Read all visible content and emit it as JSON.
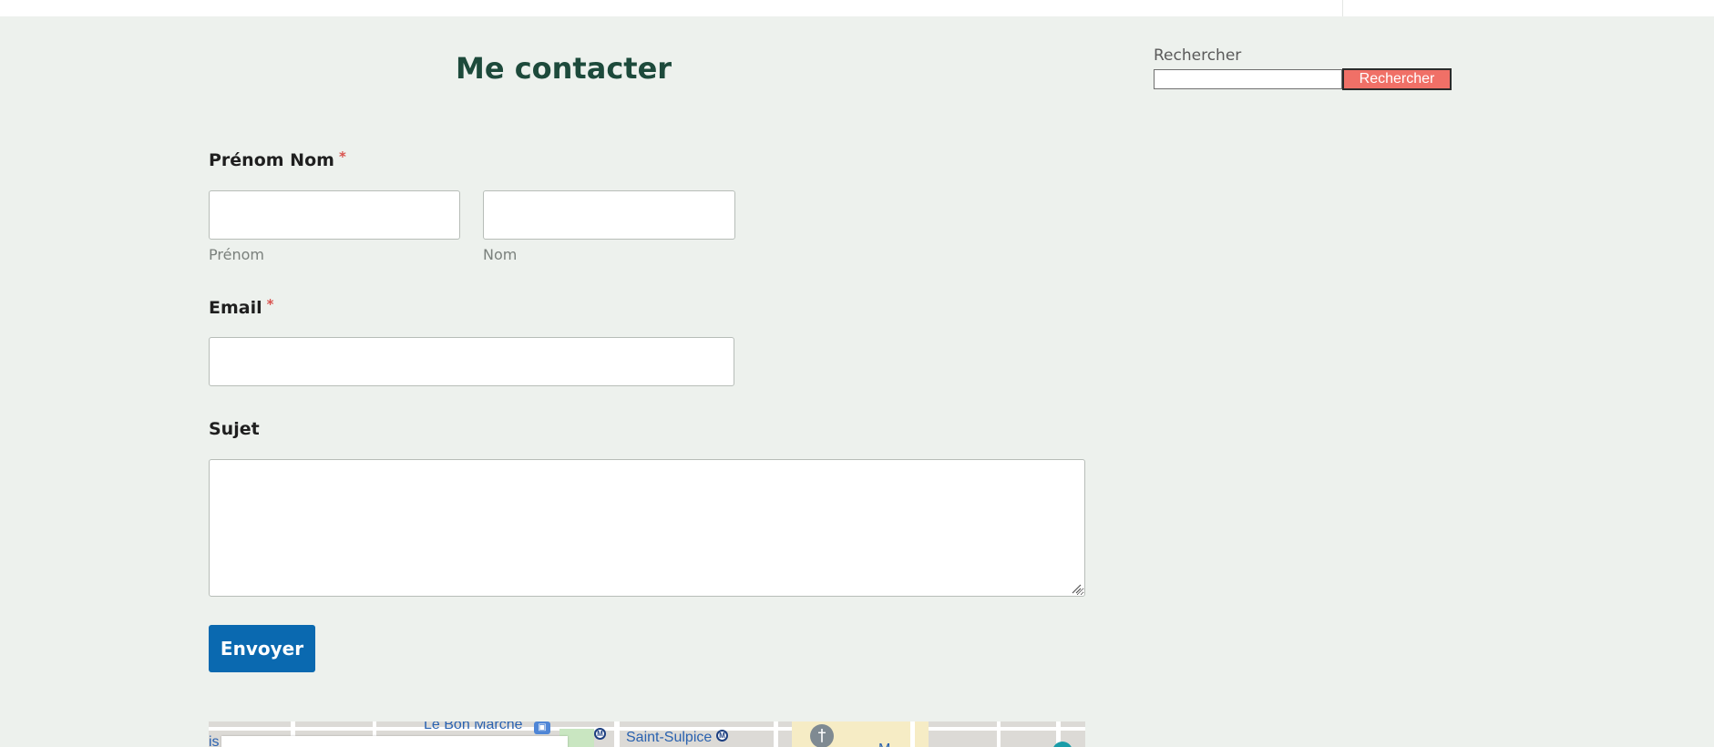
{
  "page": {
    "title": "Me contacter"
  },
  "form": {
    "name_label": "Prénom Nom",
    "required_mark": "*",
    "first_name_sublabel": "Prénom",
    "last_name_sublabel": "Nom",
    "email_label": "Email",
    "subject_label": "Sujet",
    "submit_label": "Envoyer",
    "first_name_value": "",
    "last_name_value": "",
    "email_value": "",
    "subject_value": ""
  },
  "sidebar": {
    "search_label": "Rechercher",
    "search_value": "",
    "search_button_label": "Rechercher"
  },
  "map": {
    "labels": {
      "edge": "is",
      "bon_marche": "Le Bon Marché",
      "saint_sulpice": "Saint-Sulpice",
      "metro": "M",
      "cross": "†",
      "cut_text": "M"
    }
  },
  "colors": {
    "background": "#edf1ed",
    "title": "#1d4a3b",
    "required": "#d9534f",
    "submit_button": "#0a69b0",
    "search_button": "#f07067"
  },
  "icons": {
    "metro": "metro-icon",
    "shop": "shop-icon",
    "cemetery": "cross-icon",
    "resize": "resize-grip-icon"
  }
}
